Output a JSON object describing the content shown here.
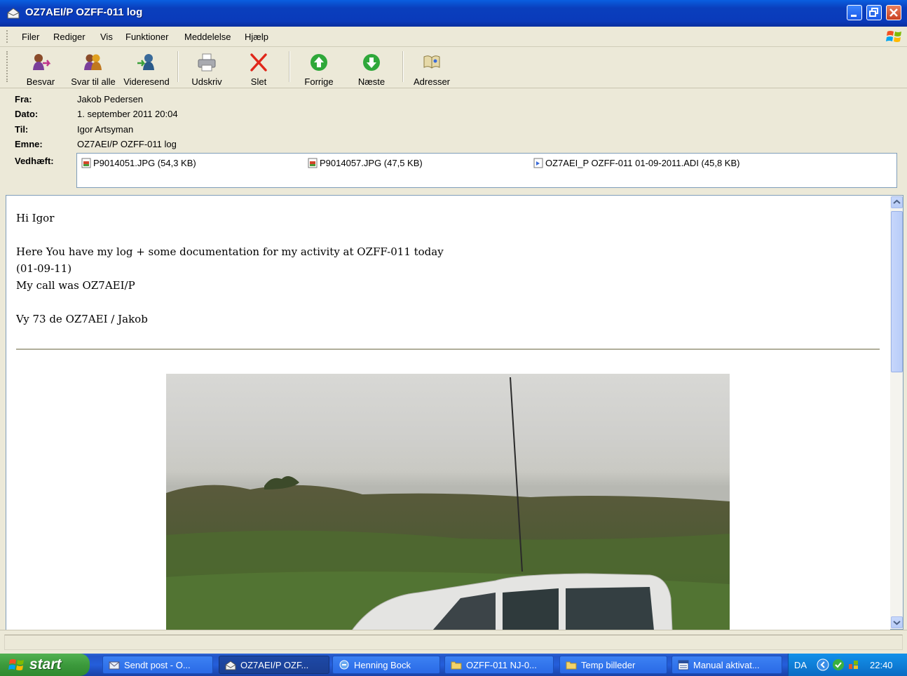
{
  "window": {
    "title": "OZ7AEI/P OZFF-011 log"
  },
  "menu": [
    "Filer",
    "Rediger",
    "Vis",
    "Funktioner",
    "Meddelelse",
    "Hjælp"
  ],
  "toolbar": {
    "reply": "Besvar",
    "reply_all": "Svar til alle",
    "forward": "Videresend",
    "print": "Udskriv",
    "delete": "Slet",
    "previous": "Forrige",
    "next": "Næste",
    "addresses": "Adresser"
  },
  "header": {
    "from_label": "Fra:",
    "from": "Jakob Pedersen",
    "date_label": "Dato:",
    "date": "1. september 2011 20:04",
    "to_label": "Til:",
    "to": "Igor Artsyman",
    "subject_label": "Emne:",
    "subject": "OZ7AEI/P OZFF-011 log",
    "attach_label": "Vedhæft:",
    "attachments": [
      "P9014051.JPG (54,3 KB)",
      "P9014057.JPG (47,5 KB)",
      "OZ7AEI_P OZFF-011 01-09-2011.ADI (45,8 KB)"
    ]
  },
  "message": {
    "greeting": "Hi Igor",
    "line1": "Here You have my log + some documentation for my activity at OZFF-011 today",
    "line2": "(01-09-11)",
    "line3": "My call was OZ7AEI/P",
    "signoff": "Vy 73 de OZ7AEI / Jakob"
  },
  "taskbar": {
    "start": "start",
    "tasks": [
      "Sendt post - O...",
      "OZ7AEI/P OZF...",
      "Henning Bock",
      "OZFF-011 NJ-0...",
      "Temp billeder",
      "Manual aktivat..."
    ],
    "lang": "DA",
    "clock": "22:40"
  }
}
